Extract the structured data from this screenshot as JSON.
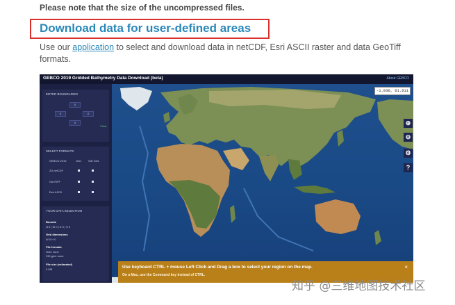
{
  "note": "Please note that the size of the uncompressed files.",
  "heading": "Download data for user-defined areas",
  "intro": {
    "before_link": "Use our ",
    "link": "application",
    "after_link": " to select and download data in netCDF, Esri ASCII raster and data GeoTiff formats."
  },
  "app": {
    "title": "GEBCO 2019 Gridded Bathymetry Data Download (beta)",
    "about": "About GEBCO",
    "boundaries": {
      "title": "ENTER BOUNDARIES",
      "north": "0",
      "west": "0",
      "east": "0",
      "south": "0",
      "clear": "Clear"
    },
    "formats": {
      "title": "SELECT FORMATS",
      "col_header": "GEBCO 2019",
      "col_grid": "Grid",
      "col_sid": "SID Grid",
      "rows": [
        "2D netCDF",
        "GeoTIFF",
        "Esri ASCII"
      ]
    },
    "selection": {
      "title": "YOUR DATA SELECTION",
      "bounds_label": "Bounds",
      "bounds_value": "N 0 | W 0 | E 0 | S 0",
      "dims_label": "Grid dimensions",
      "dims_value": "W 0 H 0",
      "formats_label": "File formats",
      "grid_value": "Grid: none",
      "sid_value": "SID grid: none",
      "size_label": "File size (estimated)",
      "size_value": "0 MB"
    },
    "coords": "-1.936,  61.611",
    "banner": {
      "line1": "Use keyboard CTRL + mouse Left Click and Drag a box to select your region on the map.",
      "line2": "On a Mac, use the Command key instead of CTRL.",
      "close": "×"
    },
    "icons": [
      "zoom-in-icon",
      "zoom-out-icon",
      "settings-icon",
      "help-icon"
    ]
  },
  "watermark": "知乎 @三维地图技术社区"
}
